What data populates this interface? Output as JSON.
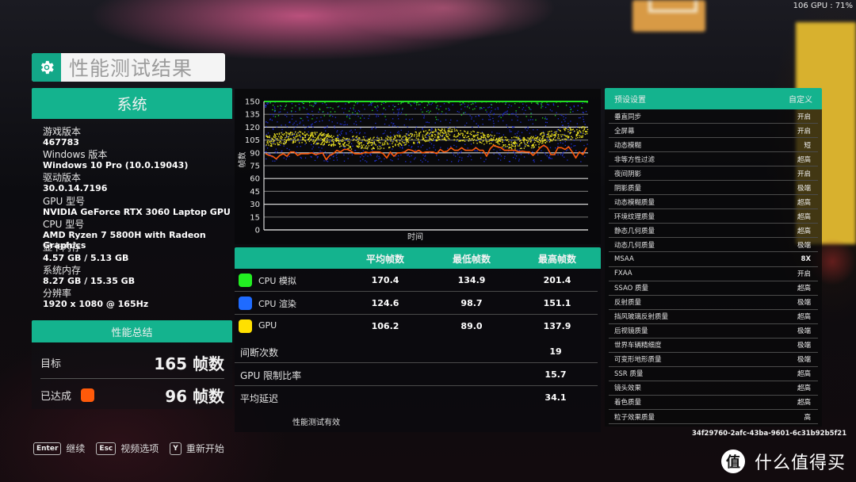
{
  "overlay": {
    "gpu_readout": "106 GPU : 71%"
  },
  "title": {
    "text": "性能测试结果",
    "icon": "gear-icon"
  },
  "system": {
    "header": "系统",
    "items": [
      {
        "label": "游戏版本",
        "value": "467783"
      },
      {
        "label": "Windows 版本",
        "value": "Windows 10 Pro (10.0.19043)"
      },
      {
        "label": "驱动版本",
        "value": "30.0.14.7196"
      },
      {
        "label": "GPU 型号",
        "value": "NVIDIA GeForce RTX 3060 Laptop GPU"
      },
      {
        "label": "CPU 型号",
        "value": "AMD Ryzen 7 5800H with Radeon Graphics"
      },
      {
        "label": "显卡内存",
        "value": "4.57 GB / 5.13 GB"
      },
      {
        "label": "系统内存",
        "value": "8.27 GB / 15.35 GB"
      },
      {
        "label": "分辨率",
        "value": "1920 x 1080 @ 165Hz"
      }
    ]
  },
  "summary": {
    "header": "性能总结",
    "target_label": "目标",
    "target_value": "165 帧数",
    "achieved_label": "已达成",
    "achieved_value": "96 帧数",
    "achieved_color": "#ff5a0a"
  },
  "footer": {
    "keys": [
      {
        "key": "Enter",
        "label": "继续"
      },
      {
        "key": "Esc",
        "label": "视频选项"
      },
      {
        "key": "Y",
        "label": "重新开始"
      }
    ]
  },
  "chart_data": {
    "type": "scatter",
    "title": "",
    "xlabel": "时间",
    "ylabel": "帧数",
    "ylim": [
      0,
      150
    ],
    "yticks": [
      0,
      15,
      30,
      45,
      60,
      75,
      90,
      105,
      120,
      135,
      150
    ],
    "grid": true,
    "legend": "none",
    "series": [
      {
        "name": "CPU 模拟",
        "color": "#22dd22",
        "style": "scatter",
        "band": [
          135,
          150
        ],
        "clipped_at": 150
      },
      {
        "name": "CPU 渲染",
        "color": "#1f2fd8",
        "style": "scatter",
        "band": [
          80,
          150
        ]
      },
      {
        "name": "GPU",
        "color": "#e6dc20",
        "style": "scatter",
        "band": [
          95,
          120
        ]
      },
      {
        "name": "已达成",
        "color": "#ff5a0a",
        "style": "line",
        "values": [
          89,
          87,
          86,
          83,
          87,
          89,
          86,
          91,
          91,
          87,
          89,
          89,
          89,
          90,
          88,
          89,
          90,
          82,
          87,
          89,
          93,
          91,
          94,
          94,
          92,
          89,
          89,
          89,
          91,
          90,
          91,
          91,
          91,
          89,
          84,
          91,
          86,
          90,
          90,
          91,
          94,
          93,
          91,
          93,
          90,
          91,
          91,
          91,
          89,
          94,
          91,
          92,
          96,
          93,
          93,
          96,
          93,
          93,
          93,
          96,
          93,
          93,
          86,
          95,
          99,
          97,
          96,
          93,
          93,
          93,
          93,
          91,
          92,
          91,
          91,
          87,
          91,
          96,
          99,
          96,
          88,
          88,
          96,
          96,
          94,
          97,
          91,
          84,
          91,
          88,
          96
        ]
      }
    ]
  },
  "stats": {
    "columns": [
      "",
      "平均帧数",
      "最低帧数",
      "最高帧数"
    ],
    "rows": [
      {
        "label": "CPU 模拟",
        "color": "#22ee22",
        "avg": "170.4",
        "min": "134.9",
        "max": "201.4"
      },
      {
        "label": "CPU 渲染",
        "color": "#1f6bff",
        "avg": "124.6",
        "min": "98.7",
        "max": "151.1"
      },
      {
        "label": "GPU",
        "color": "#ffe000",
        "avg": "106.2",
        "min": "89.0",
        "max": "137.9"
      }
    ],
    "extras": [
      {
        "label": "间断次数",
        "value": "19"
      },
      {
        "label": "GPU 限制比率",
        "value": "15.7"
      },
      {
        "label": "平均延迟",
        "value": "34.1"
      }
    ],
    "valid_text": "性能测试有效"
  },
  "settings": {
    "header_label": "预设设置",
    "header_value": "自定义",
    "rows": [
      {
        "label": "垂直同步",
        "value": "开启"
      },
      {
        "label": "全屏幕",
        "value": "开启"
      },
      {
        "label": "动态模糊",
        "value": "短"
      },
      {
        "label": "非等方性过滤",
        "value": "超高"
      },
      {
        "label": "夜间阴影",
        "value": "开启"
      },
      {
        "label": "阴影质量",
        "value": "极端"
      },
      {
        "label": "动态模糊质量",
        "value": "超高"
      },
      {
        "label": "环境纹理质量",
        "value": "超高"
      },
      {
        "label": "静态几何质量",
        "value": "超高"
      },
      {
        "label": "动态几何质量",
        "value": "极端"
      },
      {
        "label": "MSAA",
        "value": "8X"
      },
      {
        "label": "FXAA",
        "value": "开启"
      },
      {
        "label": "SSAO 质量",
        "value": "超高"
      },
      {
        "label": "反射质量",
        "value": "极端"
      },
      {
        "label": "挡风玻璃反射质量",
        "value": "超高"
      },
      {
        "label": "后视镜质量",
        "value": "极端"
      },
      {
        "label": "世界车辆精细度",
        "value": "极端"
      },
      {
        "label": "可变形地形质量",
        "value": "极端"
      },
      {
        "label": "SSR 质量",
        "value": "超高"
      },
      {
        "label": "镜头效果",
        "value": "超高"
      },
      {
        "label": "着色质量",
        "value": "超高"
      },
      {
        "label": "粒子效果质量",
        "value": "高"
      }
    ],
    "hash": "34f29760-2afc-43ba-9601-6c31b92b5f21"
  },
  "watermark": {
    "logo": "值",
    "text": "什么值得买"
  }
}
